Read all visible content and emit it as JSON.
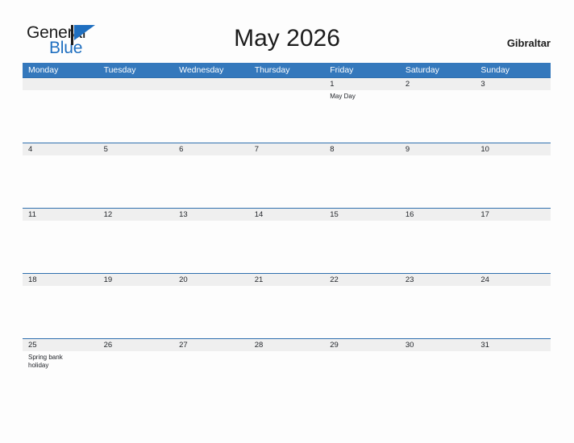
{
  "brand": {
    "name_part1": "General",
    "name_part2": "Blue",
    "flag_icon": "flag-icon",
    "accent_color": "#1f6fc0"
  },
  "header": {
    "title": "May 2026",
    "location": "Gibraltar"
  },
  "colors": {
    "header_bar": "#3478bc",
    "week_divider": "#2f6fae",
    "date_band": "#efefef",
    "page_background": "#fdfdfd",
    "text": "#23262b"
  },
  "calendar": {
    "weekdays": [
      "Monday",
      "Tuesday",
      "Wednesday",
      "Thursday",
      "Friday",
      "Saturday",
      "Sunday"
    ],
    "weeks": [
      [
        {
          "date": "",
          "event": ""
        },
        {
          "date": "",
          "event": ""
        },
        {
          "date": "",
          "event": ""
        },
        {
          "date": "",
          "event": ""
        },
        {
          "date": "1",
          "event": "May Day"
        },
        {
          "date": "2",
          "event": ""
        },
        {
          "date": "3",
          "event": ""
        }
      ],
      [
        {
          "date": "4",
          "event": ""
        },
        {
          "date": "5",
          "event": ""
        },
        {
          "date": "6",
          "event": ""
        },
        {
          "date": "7",
          "event": ""
        },
        {
          "date": "8",
          "event": ""
        },
        {
          "date": "9",
          "event": ""
        },
        {
          "date": "10",
          "event": ""
        }
      ],
      [
        {
          "date": "11",
          "event": ""
        },
        {
          "date": "12",
          "event": ""
        },
        {
          "date": "13",
          "event": ""
        },
        {
          "date": "14",
          "event": ""
        },
        {
          "date": "15",
          "event": ""
        },
        {
          "date": "16",
          "event": ""
        },
        {
          "date": "17",
          "event": ""
        }
      ],
      [
        {
          "date": "18",
          "event": ""
        },
        {
          "date": "19",
          "event": ""
        },
        {
          "date": "20",
          "event": ""
        },
        {
          "date": "21",
          "event": ""
        },
        {
          "date": "22",
          "event": ""
        },
        {
          "date": "23",
          "event": ""
        },
        {
          "date": "24",
          "event": ""
        }
      ],
      [
        {
          "date": "25",
          "event": "Spring bank holiday"
        },
        {
          "date": "26",
          "event": ""
        },
        {
          "date": "27",
          "event": ""
        },
        {
          "date": "28",
          "event": ""
        },
        {
          "date": "29",
          "event": ""
        },
        {
          "date": "30",
          "event": ""
        },
        {
          "date": "31",
          "event": ""
        }
      ]
    ]
  }
}
